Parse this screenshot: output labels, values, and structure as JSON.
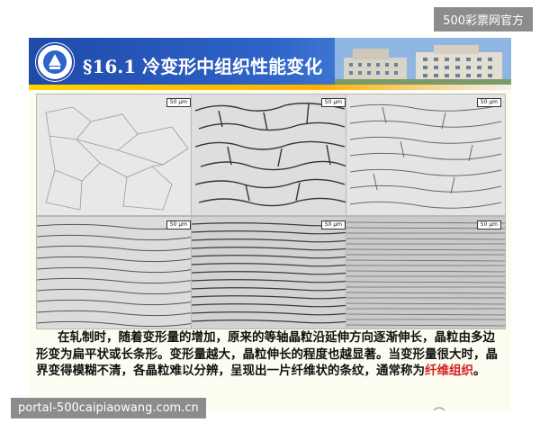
{
  "overlay": {
    "top_right": "500彩票网官方",
    "bottom_left": "portal-500caipiaowang.com.cn"
  },
  "header": {
    "title": "§16.1  冷变形中组织性能变化"
  },
  "micrographs": [
    {
      "scale": "50 μm"
    },
    {
      "scale": "50 μm"
    },
    {
      "scale": "50 μm"
    },
    {
      "scale": "50 μm"
    },
    {
      "scale": "50 μm"
    },
    {
      "scale": "50 μm"
    }
  ],
  "description": {
    "text": "在轧制时，随着变形量的增加，原来的等轴晶粒沿延伸方向逐渐伸长，晶粒由多边形变为扁平状或长条形。变形量越大，晶粒伸长的程度也越显著。当变形量很大时，晶界变得模糊不清，各晶粒难以分辨，呈现出一片纤维状的条纹，通常称为",
    "highlight": "纤维组织",
    "end": "。"
  },
  "colors": {
    "banner": "#2e63c9",
    "stripe": "#ffd400",
    "highlight": "#d42020"
  }
}
